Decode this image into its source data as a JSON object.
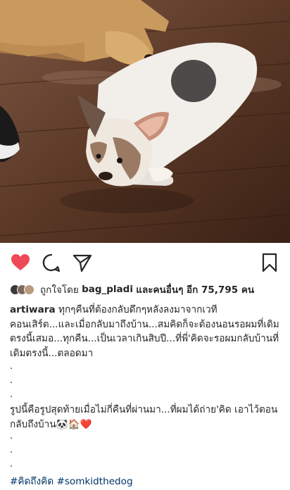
{
  "post": {
    "likes_prefix": "ถูกใจโดย",
    "liked_by_user": "bag_pladi",
    "likes_suffix": "และคนอื่นๆ อีก 75,795 คน",
    "author": "artiwara",
    "caption_1": "ทุกๆคืนที่ต้องกลับดึกๆหลังลงมาจากเวทีคอนเสิร์ต...และเมื่อกลับมาถึงบ้าน...สมคิดก็จะต้องนอนรอผมที่เดิมตรงนี้เสมอ...ทุกคืน...เป็นเวลาเกินสิบปี...ที่พี่'คิดจะรอผมกลับบ้านที่เดิมตรงนี้...ตลอดมา",
    "caption_2": "รูปนี้คือรูปสุดท้ายเมื่อไม่กี่คืนที่ผ่านมา...ที่ผมได้ถ่าย'คิด เอาไว้ตอนกลับถึงบ้าน🐼🏠❤️",
    "dot": ".",
    "hashtag_1": "#คิดถึงคิด",
    "hashtag_2": "#somkidthedog"
  },
  "icons": {
    "like": "heart-filled-icon",
    "comment": "comment-bubble-icon",
    "share": "paper-plane-icon",
    "save": "bookmark-icon"
  },
  "colors": {
    "heart": "#ed4956",
    "hashtag": "#003569",
    "text": "#262626"
  }
}
